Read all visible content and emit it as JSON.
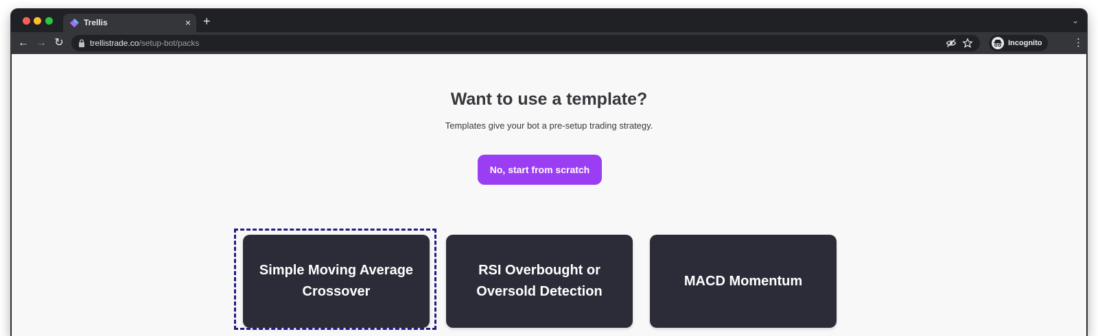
{
  "browser": {
    "tab": {
      "title": "Trellis",
      "close_glyph": "×",
      "favicon": "trellis-diamond-icon"
    },
    "new_tab_glyph": "+",
    "tab_menu_glyph": "⌄",
    "nav": {
      "back_glyph": "←",
      "forward_glyph": "→",
      "reload_glyph": "↻"
    },
    "url": {
      "host": "trellistrade.co",
      "path": "/setup-bot/packs"
    },
    "incognito_label": "Incognito",
    "kebab_glyph": "⋮",
    "colors": {
      "traffic_red": "#ff5f57",
      "traffic_yellow": "#febc2e",
      "traffic_green": "#28c840"
    }
  },
  "page": {
    "title": "Want to use a template?",
    "subtitle": "Templates give your bot a pre-setup trading strategy.",
    "scratch_button": "No, start from scratch",
    "templates": [
      {
        "label": "Simple Moving Average Crossover",
        "selected": true
      },
      {
        "label": "RSI Overbought or Oversold Detection",
        "selected": false
      },
      {
        "label": "MACD Momentum",
        "selected": false
      }
    ],
    "colors": {
      "accent": "#9b3ef3",
      "card_bg": "#2c2c38",
      "highlight_border": "#1f1a80",
      "page_bg": "#f8f8f8"
    }
  }
}
